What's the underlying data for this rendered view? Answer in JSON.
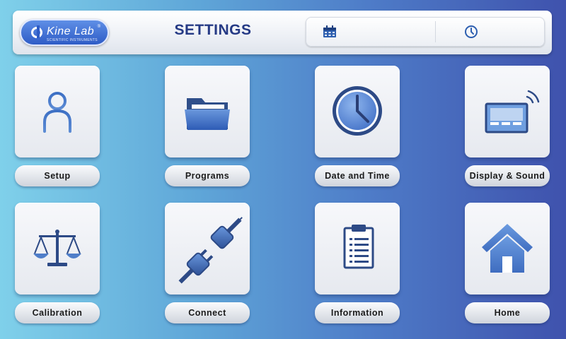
{
  "header": {
    "logo": {
      "name": "Kine Lab",
      "tagline": "SCIENTIFIC INSTRUMENTS",
      "registered": "®"
    },
    "title": "SETTINGS",
    "date_value": "",
    "time_value": "",
    "calendar_icon": "calendar-icon",
    "clock_icon": "clock-icon"
  },
  "tiles": [
    {
      "label": "Setup",
      "icon": "user-icon"
    },
    {
      "label": "Programs",
      "icon": "folder-icon"
    },
    {
      "label": "Date and Time",
      "icon": "clock-icon"
    },
    {
      "label": "Display & Sound",
      "icon": "display-icon"
    },
    {
      "label": "Calibration",
      "icon": "balance-scale-icon"
    },
    {
      "label": "Connect",
      "icon": "plug-icon"
    },
    {
      "label": "Information",
      "icon": "clipboard-icon"
    },
    {
      "label": "Home",
      "icon": "home-icon"
    }
  ],
  "colors": {
    "title": "#253a85",
    "icon_dark": "#2d4a86",
    "icon_light": "#5c8bd4",
    "background_left": "#7fd0ea",
    "background_right": "#3f52ad"
  }
}
